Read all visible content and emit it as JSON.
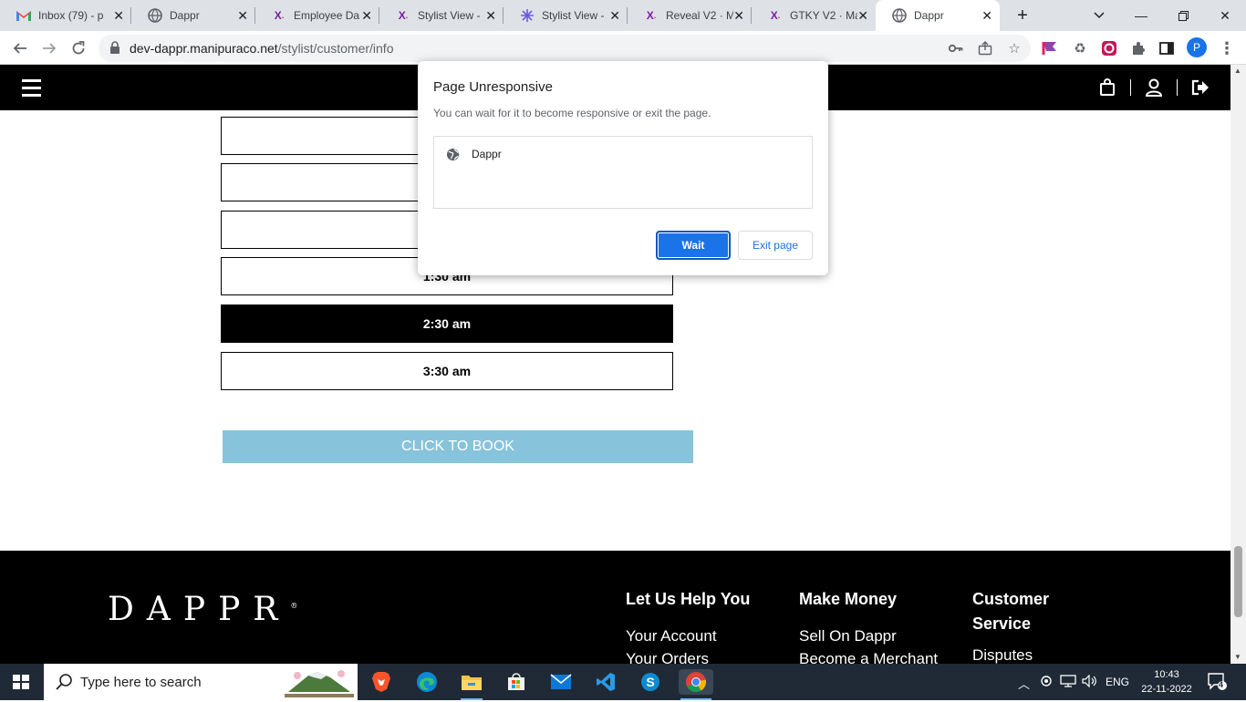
{
  "browser": {
    "tabs": [
      {
        "title": "Inbox (79) - p",
        "icon": "gmail-icon"
      },
      {
        "title": "Dappr",
        "icon": "globe-icon"
      },
      {
        "title": "Employee Da",
        "icon": "x-logo-icon"
      },
      {
        "title": "Stylist View -",
        "icon": "x-logo-icon"
      },
      {
        "title": "Stylist View -",
        "icon": "flower-icon"
      },
      {
        "title": "Reveal V2 · M",
        "icon": "x-logo-icon"
      },
      {
        "title": "GTKY V2 · Ma",
        "icon": "x-logo-icon"
      },
      {
        "title": "Dappr",
        "icon": "globe-icon",
        "active": true
      }
    ],
    "url_host": "dev-dappr.manipuraco.net",
    "url_path": "/stylist/customer/info",
    "profile_initial": "P",
    "accent": "#1a73e8"
  },
  "time_slots": [
    {
      "label": "",
      "selected": false
    },
    {
      "label": "",
      "selected": false
    },
    {
      "label": "",
      "selected": false
    },
    {
      "label": "1:30 am",
      "selected": false
    },
    {
      "label": "2:30 am",
      "selected": true
    },
    {
      "label": "3:30 am",
      "selected": false
    }
  ],
  "book_button": {
    "label": "CLICK TO BOOK",
    "color": "#87c3db"
  },
  "footer": {
    "logo": "DAPPR",
    "logo_mark": "®",
    "columns": [
      {
        "heading": "Let Us Help You",
        "links": [
          "Your Account",
          "Your Orders"
        ]
      },
      {
        "heading": "Make Money",
        "links": [
          "Sell On Dappr",
          "Become a Merchant"
        ]
      },
      {
        "heading": "Customer Service",
        "links": [
          "Disputes"
        ]
      }
    ]
  },
  "dialog": {
    "title": "Page Unresponsive",
    "message": "You can wait for it to become responsive or exit the page.",
    "page_name": "Dappr",
    "wait_label": "Wait",
    "exit_label": "Exit page"
  },
  "taskbar": {
    "search_placeholder": "Type here to search",
    "language": "ENG",
    "time": "10:43",
    "date": "22-11-2022",
    "notification_count": "4"
  }
}
